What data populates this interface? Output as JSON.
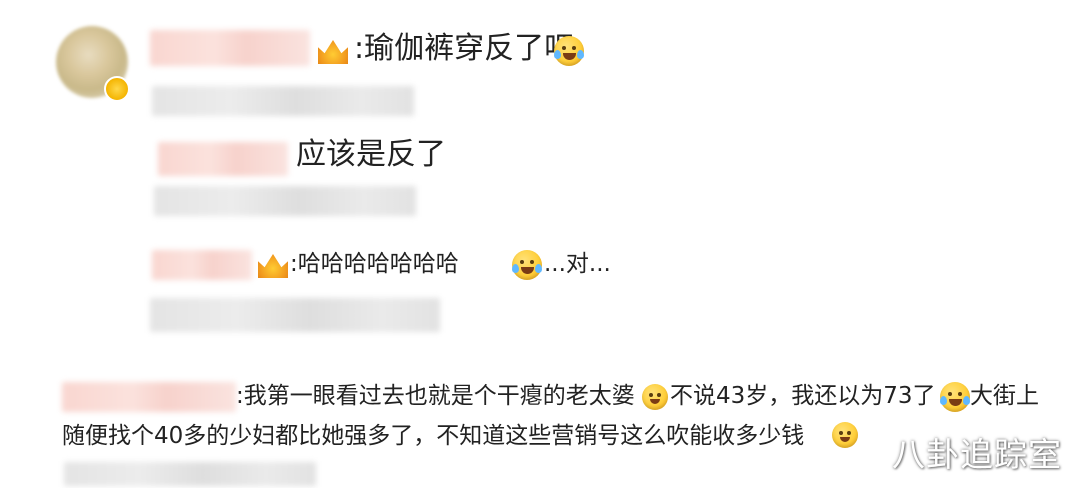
{
  "comments": [
    {
      "text": ":瑜伽裤穿反了吧"
    },
    {
      "text": "应该是反了"
    },
    {
      "text": ":哈哈哈哈哈哈哈",
      "suffix": "...对..."
    },
    {
      "line1_a": ":我第一眼看过去也就是个干瘪的老太婆",
      "line1_b": "不说43岁，我还以为73了",
      "line1_c": "大街上",
      "line2": "随便找个40多的少妇都比她强多了，不知道这些营销号这么吹能收多少钱"
    }
  ],
  "watermark": "八卦追踪室",
  "icons": {
    "crown": "crown-badge-icon",
    "laugh_cry": "laugh-cry-emoji-icon",
    "cat": "cat-face-emoji-icon"
  },
  "colors": {
    "name_blur": "#f9d6d0",
    "meta_blur": "#e4e4e4",
    "emoji": "#ffcf3a"
  }
}
